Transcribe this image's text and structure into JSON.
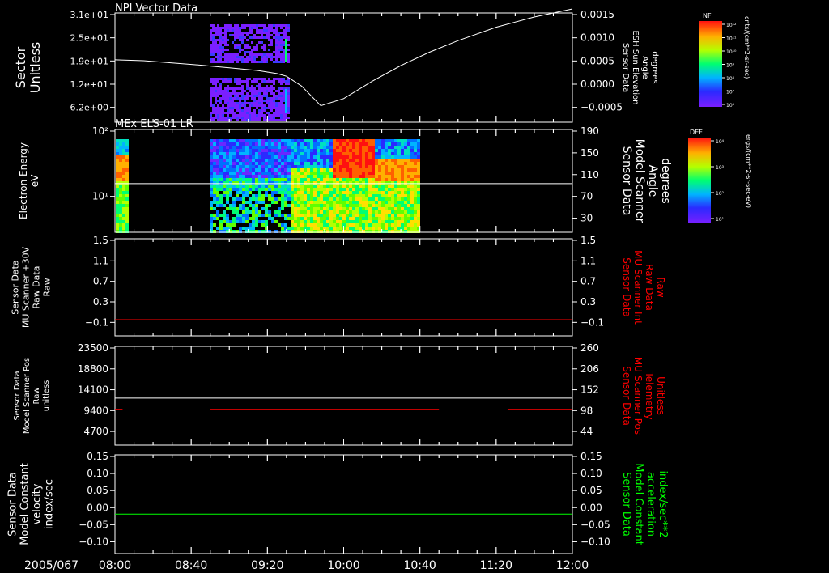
{
  "colors": {
    "background": "#000000",
    "axis": "#ffffff",
    "red_trace": "#ff0000",
    "green_trace": "#00ff00",
    "white_trace": "#ffffff",
    "spectrogram_low": "#6a28ff",
    "spectrogram_high": "#ff1010"
  },
  "chart_data": [
    {
      "type": "heatmap",
      "title": "NPI Vector Data",
      "ylabel": [
        "Sector",
        "Unitless"
      ],
      "yticks": [
        "3.1e+01",
        "2.5e+01",
        "1.9e+01",
        "1.2e+01",
        "6.2e+00"
      ],
      "ylim": [
        0,
        31
      ],
      "right_ylabel": [
        "Sensor Data",
        "ESH Sun Elevation",
        "Angle",
        "degrees"
      ],
      "right_yticks": [
        "0.0015",
        "0.0010",
        "0.0005",
        "0.0000",
        "−0.0005"
      ],
      "right_ylim": [
        -0.00095,
        0.0015
      ],
      "x_minutes": [
        0,
        15,
        30,
        45,
        60,
        75,
        85,
        90,
        98,
        108,
        120,
        135,
        150,
        165,
        180,
        200,
        220,
        240
      ],
      "overlay_values": [
        0.00045,
        0.00043,
        0.00038,
        0.00033,
        0.00027,
        0.00021,
        0.00014,
        8e-05,
        -0.00014,
        -0.00058,
        -0.00042,
        -3e-05,
        0.00032,
        0.00062,
        0.00088,
        0.00118,
        0.00141,
        0.00159
      ],
      "colorbar": {
        "label": "NF",
        "units": "cnts/(cm**2-sr-sec)",
        "ticks": [
          "10¹²",
          "10¹¹",
          "10¹⁰",
          "10⁹",
          "10⁸",
          "10⁷",
          "10⁶"
        ]
      }
    },
    {
      "type": "heatmap",
      "title": "MEx ELS-01 LR",
      "ylabel": [
        "Electron Energy",
        "eV"
      ],
      "yticks": [
        "10²",
        "10¹"
      ],
      "right_ylabel": [
        "Sensor Data",
        "Model Scanner",
        "Angle",
        "degrees"
      ],
      "right_yticks": [
        "190",
        "150",
        "110",
        "70",
        "30"
      ],
      "right_ylim": [
        0,
        190
      ],
      "overlay_value": 90,
      "colorbar": {
        "label": "DEF",
        "units": "ergs/(cm**2-sr-sec-eV)",
        "ticks": [
          "10⁴",
          "10³",
          "10²",
          "10¹"
        ]
      }
    },
    {
      "type": "line",
      "ylabel": [
        "Sensor Data",
        "MU Scanner +30V",
        "Raw Data",
        "Raw"
      ],
      "yticks": [
        "1.5",
        "1.1",
        "0.7",
        "0.3",
        "−0.1"
      ],
      "ylim": [
        -0.3,
        1.5
      ],
      "right_ylabel": [
        "Sensor Data",
        "MU Scanner Int",
        "Raw Data",
        "Raw"
      ],
      "right_yticks": [
        "1.5",
        "1.1",
        "0.7",
        "0.3",
        "−0.1"
      ],
      "series": [
        {
          "color": "#ff0000",
          "x_minutes": [
            0,
            240
          ],
          "values": [
            0,
            0
          ]
        }
      ]
    },
    {
      "type": "line",
      "ylabel": [
        "Sensor Data",
        "Model Scanner Pos",
        "Raw",
        "unitless"
      ],
      "yticks": [
        "23500",
        "18800",
        "14100",
        "9400",
        "4700"
      ],
      "ylim": [
        0,
        23500
      ],
      "right_ylabel": [
        "Sensor Data",
        "MU Scanner Pos",
        "Telemetry",
        "Unitless"
      ],
      "right_yticks": [
        "260",
        "206",
        "152",
        "98",
        "44"
      ],
      "right_ylim": [
        -10,
        260
      ],
      "series": [
        {
          "color": "#ffffff",
          "axis": "left",
          "x_minutes": [
            0,
            240
          ],
          "values": [
            11200,
            11200
          ]
        },
        {
          "color": "#ff0000",
          "axis": "right",
          "segments": [
            [
              0,
              4,
              88
            ],
            [
              50,
              170,
              88
            ],
            [
              206,
              240,
              88
            ]
          ]
        }
      ]
    },
    {
      "type": "line",
      "ylabel": [
        "Sensor Data",
        "Model Constant",
        "velocity",
        "index/sec"
      ],
      "yticks": [
        "0.15",
        "0.10",
        "0.05",
        "0.00",
        "−0.05",
        "−0.10"
      ],
      "ylim": [
        -0.1,
        0.15
      ],
      "right_ylabel": [
        "Sensor Data",
        "Model Constant",
        "acceleration",
        "index/sec**2"
      ],
      "right_yticks": [
        "0.15",
        "0.10",
        "0.05",
        "0.00",
        "−0.05",
        "−0.10"
      ],
      "series": [
        {
          "color": "#00ff00",
          "x_minutes": [
            0,
            240
          ],
          "values": [
            0,
            0
          ]
        }
      ]
    }
  ],
  "x_axis": {
    "date_label": "2005/067",
    "tick_labels": [
      "08:00",
      "08:40",
      "09:20",
      "10:00",
      "10:40",
      "11:20",
      "12:00"
    ],
    "tick_minutes": [
      0,
      40,
      80,
      120,
      160,
      200,
      240
    ]
  }
}
